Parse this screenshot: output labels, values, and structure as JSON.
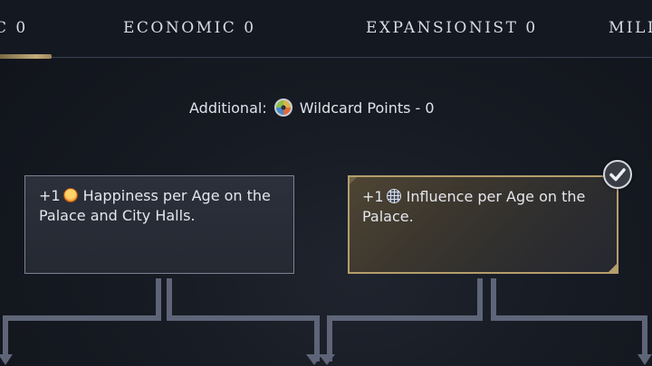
{
  "tabs": [
    {
      "label": "C 0",
      "active": true
    },
    {
      "label": "ECONOMIC 0",
      "active": false
    },
    {
      "label": "EXPANSIONIST 0",
      "active": false
    },
    {
      "label": "MILI",
      "active": false
    }
  ],
  "additional": {
    "prefix": "Additional:",
    "icon": "wildcard-icon",
    "text": "Wildcard Points - 0"
  },
  "cards": [
    {
      "prefix": "+1",
      "icon": "happiness-icon",
      "text": "Happiness per Age on the Palace and City Halls.",
      "selected": false
    },
    {
      "prefix": "+1",
      "icon": "influence-icon",
      "text": "Influence per Age on the Palace.",
      "selected": true
    }
  ],
  "colors": {
    "background": "#161a22",
    "accent_gold": "#b59e6c",
    "card_border": "#7c8294",
    "connector": "#5e6578"
  }
}
